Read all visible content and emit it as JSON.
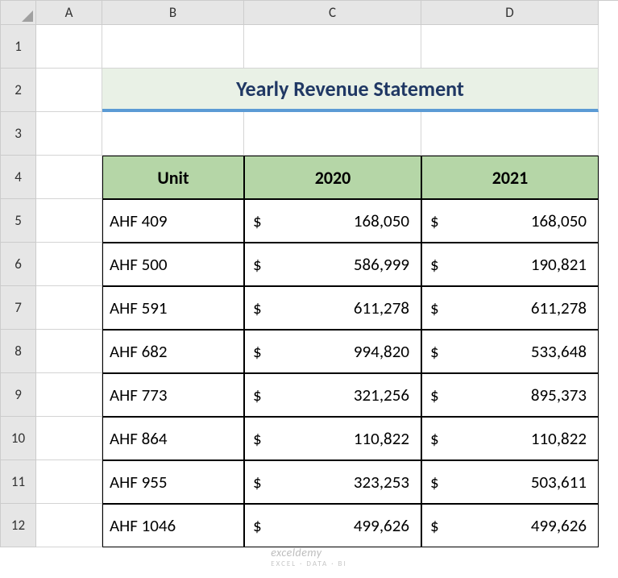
{
  "columns": [
    "A",
    "B",
    "C",
    "D"
  ],
  "rows": [
    "1",
    "2",
    "3",
    "4",
    "5",
    "6",
    "7",
    "8",
    "9",
    "10",
    "11",
    "12"
  ],
  "title": "Yearly Revenue Statement",
  "headers": {
    "unit": "Unit",
    "y1": "2020",
    "y2": "2021"
  },
  "currency": "$",
  "data": [
    {
      "unit": "AHF 409",
      "y1": "168,050",
      "y2": "168,050"
    },
    {
      "unit": "AHF 500",
      "y1": "586,999",
      "y2": "190,821"
    },
    {
      "unit": "AHF 591",
      "y1": "611,278",
      "y2": "611,278"
    },
    {
      "unit": "AHF 682",
      "y1": "994,820",
      "y2": "533,648"
    },
    {
      "unit": "AHF 773",
      "y1": "321,256",
      "y2": "895,373"
    },
    {
      "unit": "AHF 864",
      "y1": "110,822",
      "y2": "110,822"
    },
    {
      "unit": "AHF 955",
      "y1": "323,253",
      "y2": "503,611"
    },
    {
      "unit": "AHF 1046",
      "y1": "499,626",
      "y2": "499,626"
    }
  ],
  "watermark": {
    "main": "exceldemy",
    "sub": "EXCEL · DATA · BI"
  }
}
